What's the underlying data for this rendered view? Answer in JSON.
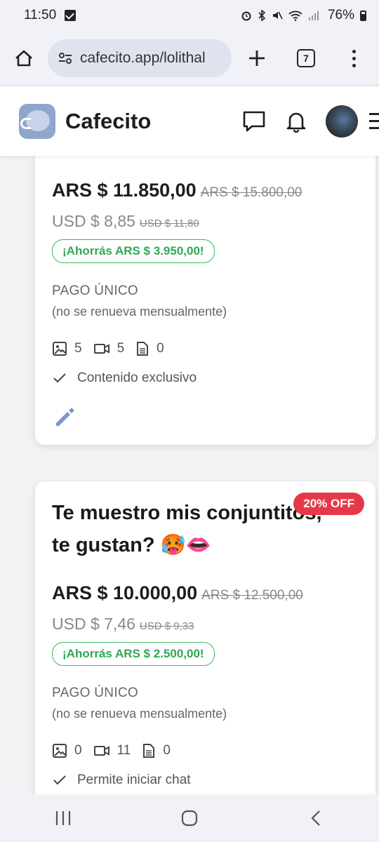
{
  "status_bar": {
    "time": "11:50",
    "battery": "76%"
  },
  "browser": {
    "url": "cafecito.app/lolithal",
    "tab_count": "7"
  },
  "header": {
    "brand": "Cafecito"
  },
  "cards": [
    {
      "price_ars": "ARS $ 11.850,00",
      "price_ars_old": "ARS $ 15.800,00",
      "price_usd": "USD $ 8,85",
      "price_usd_old": "USD $ 11,80",
      "savings": "¡Ahorrás ARS $ 3.950,00!",
      "payment_type": "PAGO ÚNICO",
      "payment_note": "(no se renueva mensualmente)",
      "images": "5",
      "videos": "5",
      "documents": "0",
      "feature": "Contenido exclusivo"
    },
    {
      "badge": "20% OFF",
      "title_line1": "Te muestro mis conjuntitos,",
      "title_line2": "te gustan? 🥵👄",
      "price_ars": "ARS $ 10.000,00",
      "price_ars_old": "ARS $ 12.500,00",
      "price_usd": "USD $ 7,46",
      "price_usd_old": "USD $ 9,33",
      "savings": "¡Ahorrás ARS $ 2.500,00!",
      "payment_type": "PAGO ÚNICO",
      "payment_note": "(no se renueva mensualmente)",
      "images": "0",
      "videos": "11",
      "documents": "0",
      "feature": "Permite iniciar chat"
    }
  ],
  "colors": {
    "accent_green": "#2fa852",
    "badge_red": "#e5394a",
    "logo_blue": "#8fa6cc"
  }
}
